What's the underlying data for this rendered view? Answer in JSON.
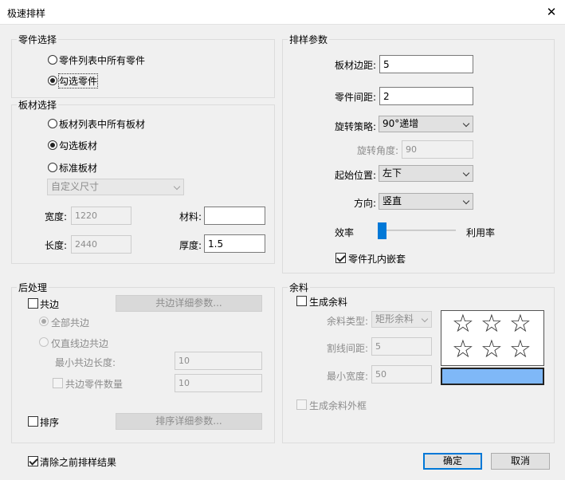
{
  "window": {
    "title": "极速排样",
    "close_glyph": "✕"
  },
  "part_select": {
    "title": "零件选择",
    "options": [
      "零件列表中所有零件",
      "勾选零件"
    ],
    "selected": 1
  },
  "sheet_select": {
    "title": "板材选择",
    "options": [
      "板材列表中所有板材",
      "勾选板材",
      "标准板材"
    ],
    "selected": 1,
    "custom_size": {
      "value": "自定义尺寸"
    },
    "width": {
      "label": "宽度:",
      "value": "1220"
    },
    "length": {
      "label": "长度:",
      "value": "2440"
    },
    "material": {
      "label": "材料:",
      "value": ""
    },
    "thickness": {
      "label": "厚度:",
      "value": "1.5"
    }
  },
  "nest_params": {
    "title": "排样参数",
    "sheet_margin": {
      "label": "板材边距:",
      "value": "5"
    },
    "part_spacing": {
      "label": "零件间距:",
      "value": "2"
    },
    "rotation_strategy": {
      "label": "旋转策略:",
      "value": "90°递增"
    },
    "rotation_angle": {
      "label": "旋转角度:",
      "value": "90"
    },
    "start_position": {
      "label": "起始位置:",
      "value": "左下"
    },
    "direction": {
      "label": "方向:",
      "value": "竖直"
    },
    "slider": {
      "left_label": "效率",
      "right_label": "利用率",
      "value": 0.0
    },
    "hole_nesting": {
      "label": "零件孔内嵌套",
      "checked": true
    }
  },
  "post_process": {
    "title": "后处理",
    "common_edge": {
      "label": "共边",
      "checked": false
    },
    "common_edge_button": "共边详细参数...",
    "all_common": "全部共边",
    "line_only_common": "仅直线边共边",
    "min_common_length": {
      "label": "最小共边长度:",
      "value": "10"
    },
    "common_part_count": {
      "label": "共边零件数量",
      "value": "10"
    },
    "sort": {
      "label": "排序",
      "checked": false
    },
    "sort_button": "排序详细参数..."
  },
  "remnant": {
    "title": "余料",
    "generate": {
      "label": "生成余料",
      "checked": false
    },
    "remnant_type": {
      "label": "余料类型:",
      "value": "矩形余料"
    },
    "cut_spacing": {
      "label": "割线间距:",
      "value": "5"
    },
    "min_width": {
      "label": "最小宽度:",
      "value": "50"
    },
    "outer_frame": {
      "label": "生成余料外框",
      "checked": false
    },
    "star_glyph": "☆",
    "preview_color": "#7fb8f7"
  },
  "footer": {
    "clear_previous": {
      "label": "清除之前排样结果",
      "checked": true
    },
    "ok": "确定",
    "cancel": "取消"
  }
}
